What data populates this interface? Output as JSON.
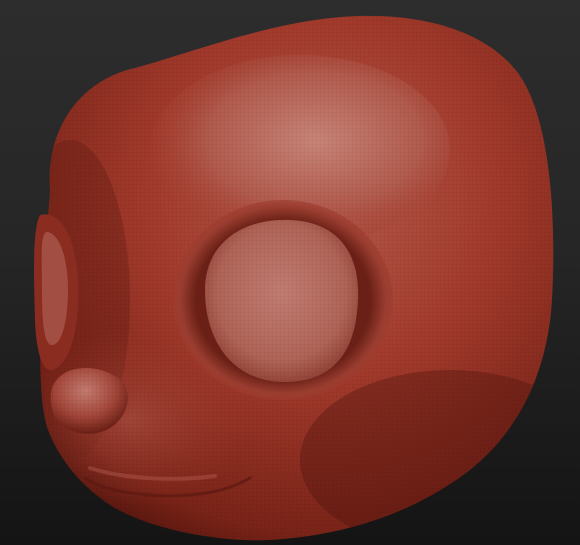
{
  "viewport": {
    "background_top": "#2d2d2d",
    "background_bottom": "#141414"
  },
  "model": {
    "subject": "sculpted-animal-head",
    "material_color": "#a5392c",
    "highlight_color": "#c07a70",
    "shadow_color": "#5c1710",
    "wireframe_visible": true
  }
}
